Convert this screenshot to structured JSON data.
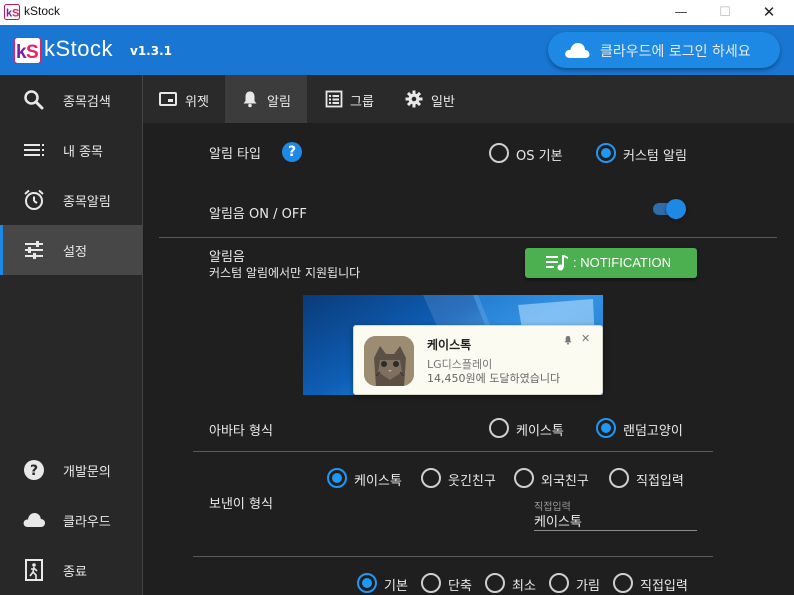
{
  "window": {
    "title": "kStock",
    "controls": {
      "minimize": "—",
      "maximize": "☐",
      "close": "✕"
    }
  },
  "header": {
    "brand": "kStock",
    "version": "v1.3.1",
    "cloud_login_label": "클라우드에 로그인 하세요"
  },
  "sidebar": {
    "items": [
      {
        "label": "종목검색",
        "icon": "search-icon"
      },
      {
        "label": "내 종목",
        "icon": "list-icon"
      },
      {
        "label": "종목알림",
        "icon": "alarm-clock-icon"
      },
      {
        "label": "설정",
        "icon": "sliders-icon",
        "active": true
      }
    ],
    "bottom_items": [
      {
        "label": "개발문의",
        "icon": "help-circle-icon"
      },
      {
        "label": "클라우드",
        "icon": "cloud-icon"
      },
      {
        "label": "종료",
        "icon": "exit-icon"
      }
    ]
  },
  "tabs": [
    {
      "label": "위젯",
      "icon": "widget-icon"
    },
    {
      "label": "알림",
      "icon": "bell-icon",
      "active": true
    },
    {
      "label": "그룹",
      "icon": "group-list-icon"
    },
    {
      "label": "일반",
      "icon": "gear-icon"
    }
  ],
  "settings": {
    "alarm_type": {
      "label": "알림 타입",
      "help": "?",
      "options": [
        "OS 기본",
        "커스텀 알림"
      ],
      "selected": "커스텀 알림"
    },
    "alarm_sound_toggle": {
      "label": "알림음 ON / OFF",
      "on": true
    },
    "alarm_sound": {
      "label": "알림음",
      "sub": "커스텀 알림에서만 지원됩니다",
      "button_label": ": NOTIFICATION"
    },
    "preview_toast": {
      "title": "케이스톡",
      "line1": "LG디스플레이",
      "line2": "14,450원에 도달하였습니다",
      "close": "✕"
    },
    "avatar_type": {
      "label": "아바타 형식",
      "options": [
        "케이스톡",
        "랜덤고양이"
      ],
      "selected": "랜덤고양이"
    },
    "sender_type": {
      "label": "보낸이 형식",
      "options": [
        "케이스톡",
        "웃긴친구",
        "외국친구",
        "직접입력"
      ],
      "selected": "케이스톡",
      "input_label": "직접입력",
      "input_value": "케이스톡"
    },
    "display_type": {
      "options": [
        "기본",
        "단축",
        "최소",
        "가림",
        "직접입력"
      ],
      "selected": "기본"
    }
  },
  "colors": {
    "accent": "#1e88e5",
    "header": "#1976d2",
    "sidebar": "#282828",
    "content": "#1f1f1f",
    "button_green": "#4caf50"
  }
}
